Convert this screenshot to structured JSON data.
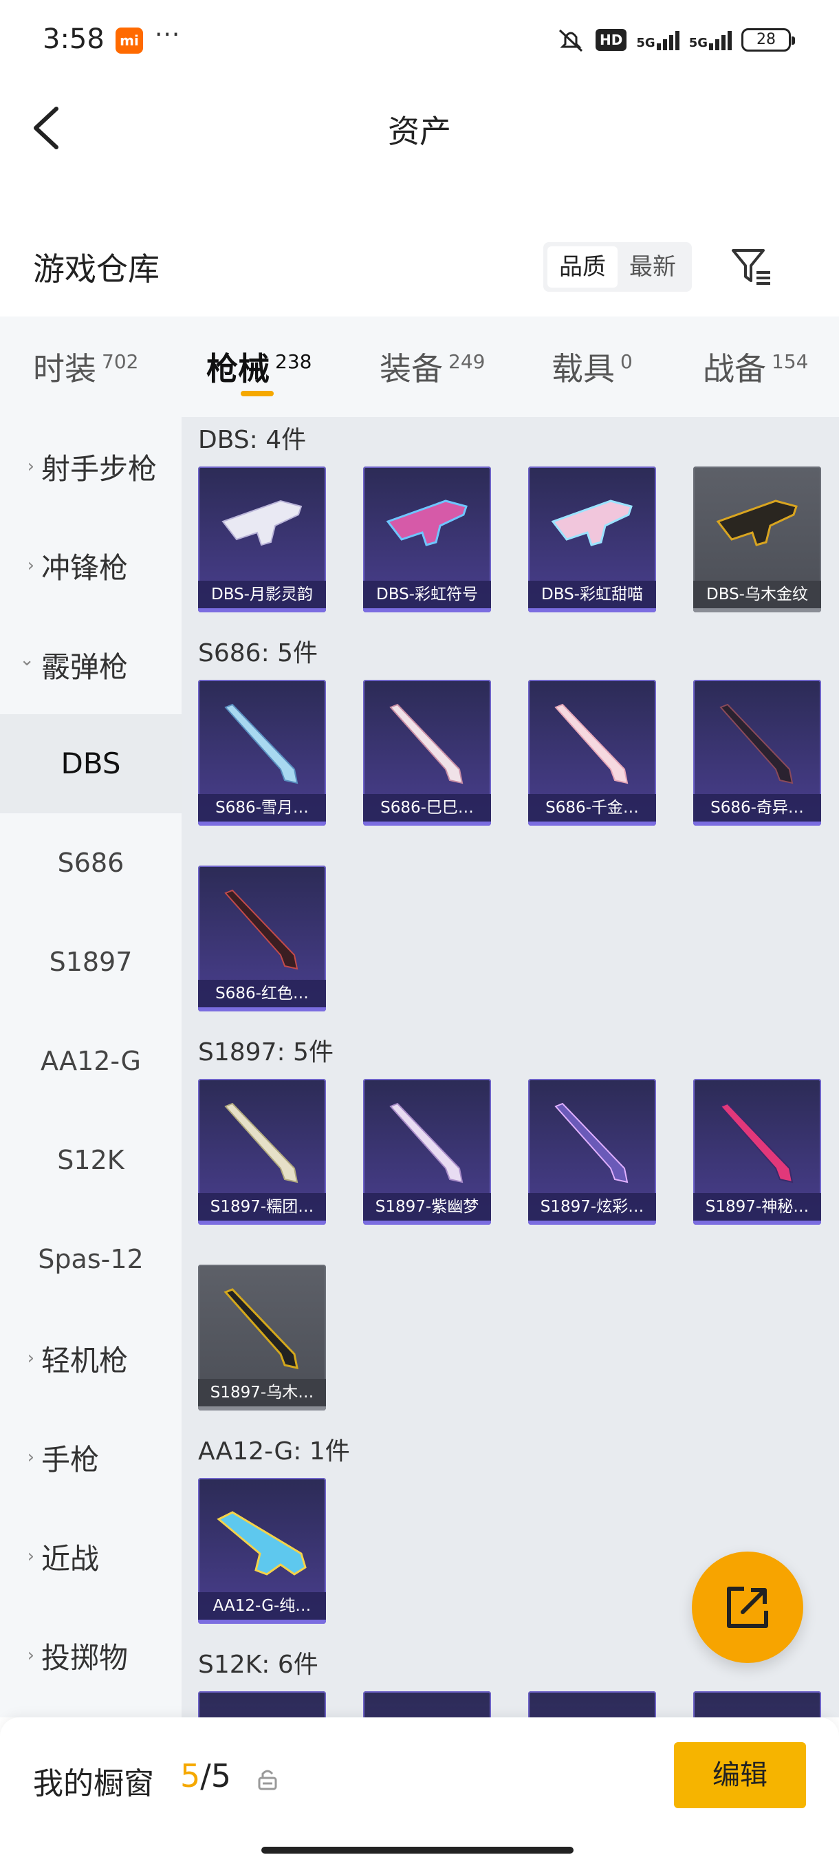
{
  "status_bar": {
    "time": "3:58",
    "app_badge": "mi",
    "more": "···",
    "hd": "HD",
    "signal1": "5G",
    "signal2": "5G",
    "battery": "28"
  },
  "header": {
    "title": "资产"
  },
  "warehouse": {
    "title": "游戏仓库",
    "sort_options": [
      "品质",
      "最新"
    ],
    "sort_active": "品质"
  },
  "tabs": [
    {
      "label": "时装",
      "count": "702"
    },
    {
      "label": "枪械",
      "count": "238",
      "active": true
    },
    {
      "label": "装备",
      "count": "249"
    },
    {
      "label": "载具",
      "count": "0"
    },
    {
      "label": "战备",
      "count": "154"
    }
  ],
  "sidebar": {
    "categories": {
      "marksman": "射手步枪",
      "smg": "冲锋枪",
      "shotgun": "霰弹枪",
      "lmg": "轻机枪",
      "pistol": "手枪",
      "melee": "近战",
      "throwable": "投掷物"
    },
    "shotgun_subs": [
      "DBS",
      "S686",
      "S1897",
      "AA12-G",
      "S12K",
      "Spas-12"
    ],
    "active_sub": "DBS",
    "chevron_right": "›",
    "chevron_down": "⌄"
  },
  "groups": [
    {
      "title": "DBS: 4件",
      "items": [
        "DBS-月影灵韵",
        "DBS-彩虹符号",
        "DBS-彩虹甜喵",
        "DBS-乌木金纹"
      ]
    },
    {
      "title": "S686: 5件",
      "items": [
        "S686-雪月…",
        "S686-巳巳…",
        "S686-千金…",
        "S686-奇异…",
        "S686-红色…"
      ]
    },
    {
      "title": "S1897: 5件",
      "items": [
        "S1897-糯团…",
        "S1897-紫幽梦",
        "S1897-炫彩…",
        "S1897-神秘…",
        "S1897-乌木…"
      ]
    },
    {
      "title": "AA12-G: 1件",
      "items": [
        "AA12-G-纯…"
      ]
    },
    {
      "title": "S12K: 6件",
      "items": []
    }
  ],
  "bottom_bar": {
    "label": "我的橱窗",
    "current": "5",
    "slash": "/",
    "total": "5",
    "edit": "编辑"
  },
  "colors": {
    "accent": "#f5a800",
    "card_purple": "#4a3f8f",
    "card_gray": "#5d6068"
  }
}
